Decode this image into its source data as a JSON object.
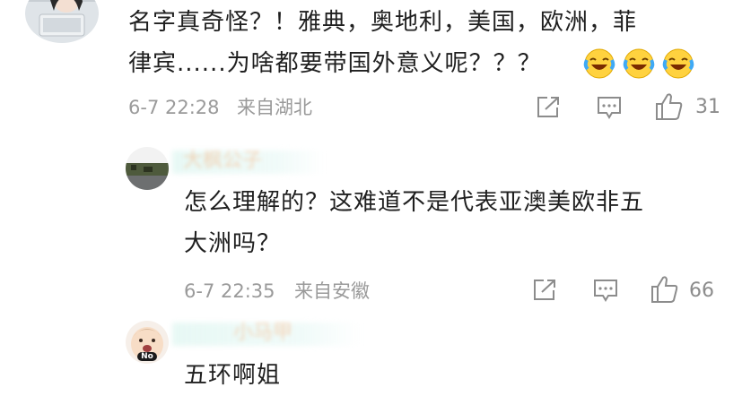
{
  "comments": [
    {
      "line1": "名字真奇怪？！雅典，奥地利，美国，欧洲，菲",
      "line2": "律宾......为啥都要带国外意义呢？？？",
      "emoji": "laughing-crying-emoji",
      "time": "6-7 22:28",
      "location": "来自湖北",
      "likes": "31"
    }
  ],
  "replies": [
    {
      "author": "大枫公子",
      "line1": "怎么理解的？这难道不是代表亚澳美欧非五",
      "line2": "大洲吗？",
      "time": "6-7 22:35",
      "location": "来自安徽",
      "likes": "66"
    },
    {
      "author": "小马甲",
      "avatar_badge": "No",
      "line1": "五环啊姐"
    }
  ],
  "icons": {
    "share": "share-icon",
    "reply": "comment-icon",
    "like": "thumbs-up-icon"
  },
  "colors": {
    "text": "#1f1f1f",
    "meta": "#9a9a9a",
    "icon": "#8c8c8c"
  }
}
